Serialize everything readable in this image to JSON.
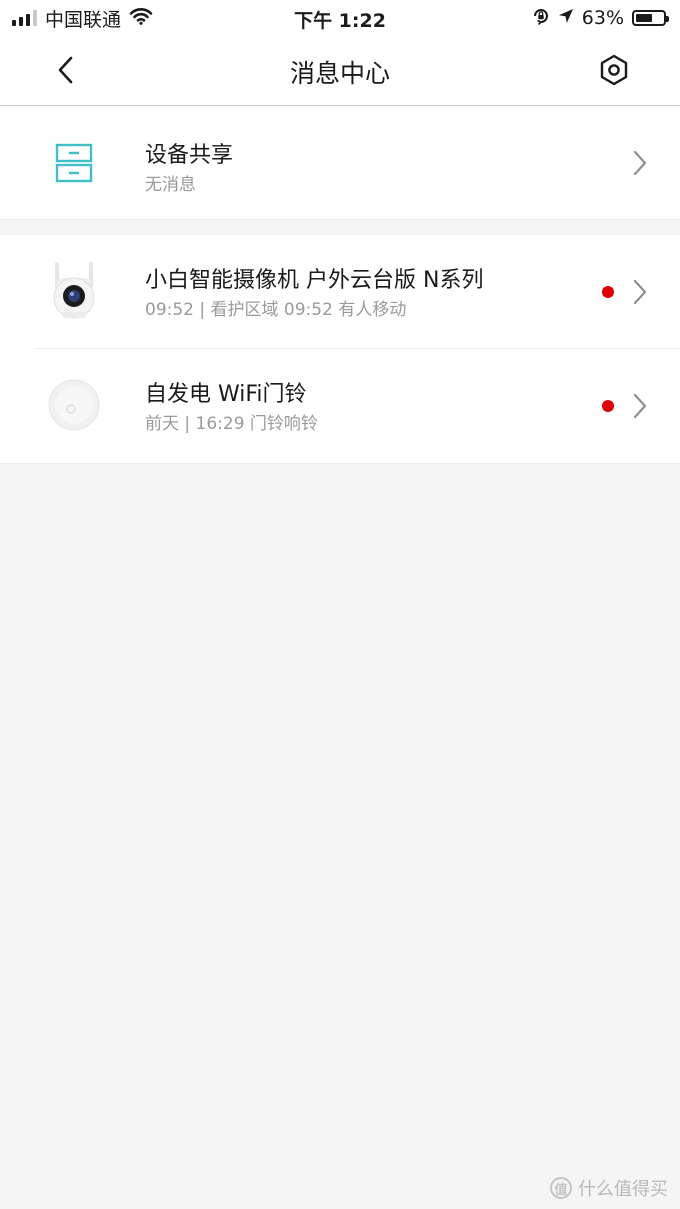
{
  "status_bar": {
    "carrier": "中国联通",
    "time": "下午 1:22",
    "battery_percent": "63%",
    "battery_level": 0.63,
    "signal_bars_filled": 3,
    "signal_bars_total": 4,
    "icons": [
      "wifi-icon",
      "orientation-lock-icon",
      "location-arrow-icon",
      "battery-icon"
    ]
  },
  "nav": {
    "title": "消息中心",
    "back_icon": "chevron-left-icon",
    "settings_icon": "hexagon-settings-icon"
  },
  "share": {
    "title": "设备共享",
    "subtitle": "无消息",
    "icon": "device-share-icon",
    "accent": "#3ec1c6"
  },
  "devices": [
    {
      "title": "小白智能摄像机 户外云台版 N系列",
      "subtitle": "09:52 | 看护区域 09:52 有人移动",
      "icon": "camera-thumbnail",
      "unread": true
    },
    {
      "title": "自发电 WiFi门铃",
      "subtitle": "前天 | 16:29 门铃响铃",
      "icon": "doorbell-thumbnail",
      "unread": true
    }
  ],
  "colors": {
    "unread_dot": "#e10000",
    "background": "#f5f5f5",
    "subtitle_text": "#9a9a9a"
  },
  "watermark": {
    "badge": "值",
    "text": "什么值得买"
  }
}
